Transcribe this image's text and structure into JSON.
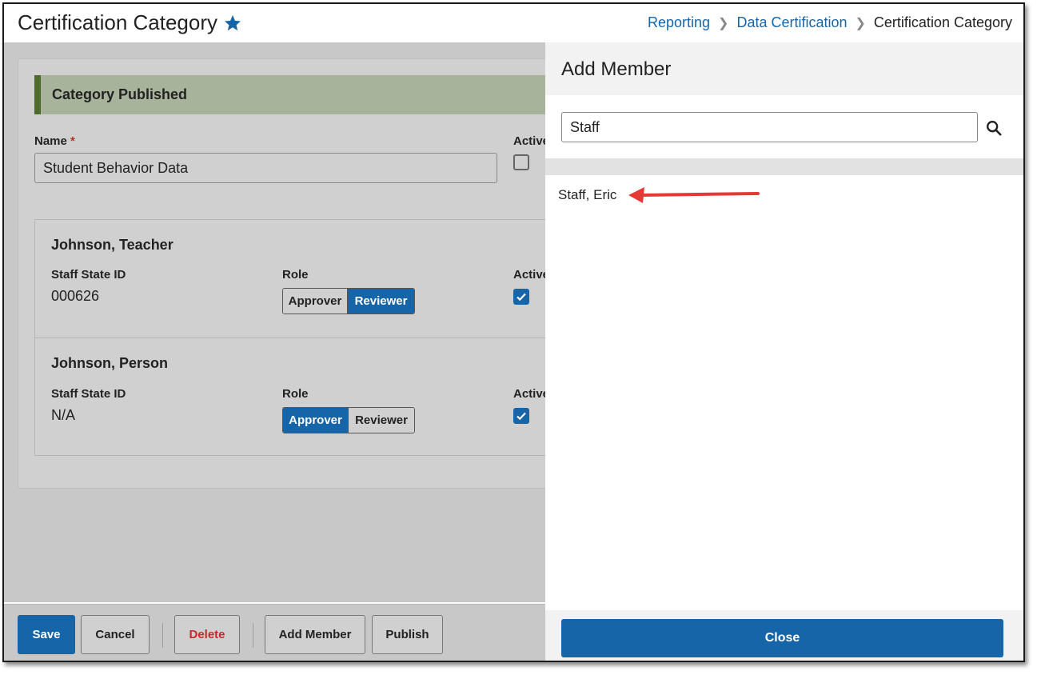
{
  "header": {
    "title": "Certification Category",
    "breadcrumb": [
      "Reporting",
      "Data Certification",
      "Certification Category"
    ]
  },
  "form": {
    "banner": "Category Published",
    "name_label": "Name",
    "required_mark": "*",
    "name_value": "Student Behavior Data",
    "active_label": "Active",
    "active_checked": false
  },
  "members": [
    {
      "name": "Johnson, Teacher",
      "staff_state_id_label": "Staff State ID",
      "staff_state_id": "000626",
      "role_label": "Role",
      "role_options": [
        "Approver",
        "Reviewer"
      ],
      "role_selected": "Reviewer",
      "active_label": "Active",
      "active_checked": true
    },
    {
      "name": "Johnson, Person",
      "staff_state_id_label": "Staff State ID",
      "staff_state_id": "N/A",
      "role_label": "Role",
      "role_options": [
        "Approver",
        "Reviewer"
      ],
      "role_selected": "Approver",
      "active_label": "Active",
      "active_checked": true
    }
  ],
  "toolbar": {
    "save": "Save",
    "cancel": "Cancel",
    "delete": "Delete",
    "add_member": "Add Member",
    "publish": "Publish"
  },
  "panel": {
    "title": "Add Member",
    "search_value": "Staff",
    "results": [
      "Staff, Eric"
    ],
    "close": "Close"
  },
  "colors": {
    "primary": "#1565a8",
    "banner_accent": "#4e6b2c",
    "annotation_arrow": "#e53935",
    "danger": "#c62828"
  }
}
